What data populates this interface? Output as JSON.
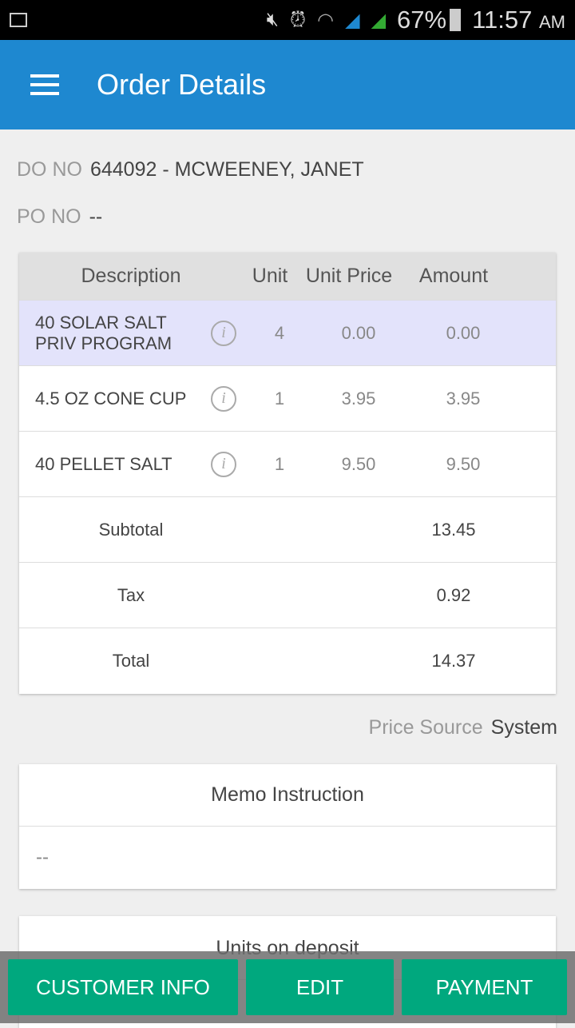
{
  "status_bar": {
    "battery": "67%",
    "time": "11:57",
    "ampm": "AM",
    "icons": [
      "image-icon",
      "mute-icon",
      "alarm-icon",
      "wifi-icon",
      "signal-icon",
      "signal-icon",
      "battery-icon"
    ]
  },
  "appbar": {
    "title": "Order Details"
  },
  "do": {
    "label": "DO NO",
    "value": "644092 - MCWEENEY, JANET"
  },
  "po": {
    "label": "PO NO",
    "value": "--"
  },
  "table": {
    "headers": [
      "Description",
      "Unit",
      "Unit Price",
      "Amount"
    ],
    "rows": [
      {
        "description": "40 SOLAR SALT PRIV PROGRAM",
        "unit": "4",
        "unit_price": "0.00",
        "amount": "0.00"
      },
      {
        "description": "4.5 OZ CONE CUP",
        "unit": "1",
        "unit_price": "3.95",
        "amount": "3.95"
      },
      {
        "description": "40 PELLET SALT",
        "unit": "1",
        "unit_price": "9.50",
        "amount": "9.50"
      }
    ],
    "summary": [
      {
        "label": "Subtotal",
        "value": "13.45"
      },
      {
        "label": "Tax",
        "value": "0.92"
      },
      {
        "label": "Total",
        "value": "14.37"
      }
    ]
  },
  "price_source": {
    "label": "Price Source",
    "value": "System"
  },
  "memo": {
    "title": "Memo Instruction",
    "value": "--"
  },
  "deposit": {
    "title": "Units on deposit"
  },
  "buttons": {
    "customer_info": "CUSTOMER INFO",
    "edit": "EDIT",
    "payment": "PAYMENT"
  },
  "colors": {
    "appbar": "#1e88d0",
    "button": "#00a87e",
    "selected_row": "#e3e3fb"
  }
}
